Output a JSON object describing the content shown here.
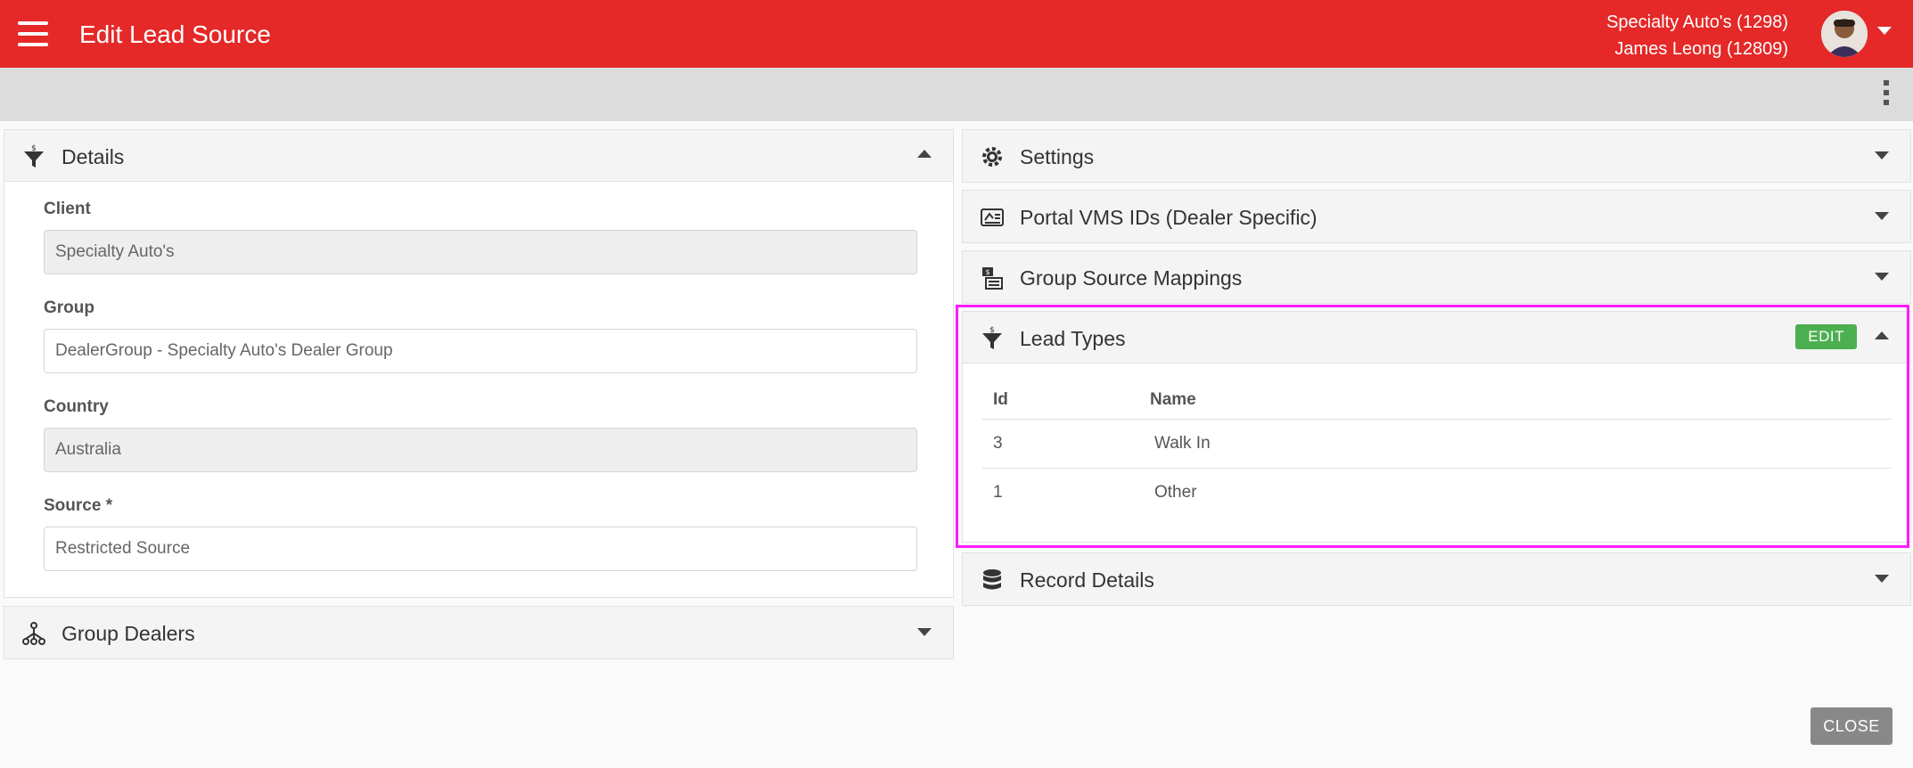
{
  "header": {
    "title": "Edit Lead Source",
    "account_line": "Specialty Auto's (1298)",
    "user_line": "James Leong (12809)",
    "menu_icon": "hamburger-icon",
    "avatar_icon": "user-avatar"
  },
  "toolbar": {
    "more_icon": "more-vert-icon"
  },
  "details": {
    "title": "Details",
    "client_label": "Client",
    "client_value": "Specialty Auto's",
    "group_label": "Group",
    "group_value": "DealerGroup - Specialty Auto's Dealer Group",
    "country_label": "Country",
    "country_value": "Australia",
    "source_label": "Source *",
    "source_value": "Restricted Source"
  },
  "group_dealers": {
    "title": "Group Dealers"
  },
  "settings": {
    "title": "Settings"
  },
  "portal_vms": {
    "title": "Portal VMS IDs (Dealer Specific)"
  },
  "group_source_mappings": {
    "title": "Group Source Mappings"
  },
  "lead_types": {
    "title": "Lead Types",
    "edit_label": "EDIT",
    "columns": [
      "Id",
      "Name"
    ],
    "rows": [
      {
        "id": "3",
        "name": "Walk In"
      },
      {
        "id": "1",
        "name": "Other"
      }
    ]
  },
  "record_details": {
    "title": "Record Details"
  },
  "footer": {
    "close_label": "CLOSE"
  },
  "colors": {
    "primary": "#e52828",
    "highlight": "#ff1aff",
    "edit": "#4caf50"
  }
}
